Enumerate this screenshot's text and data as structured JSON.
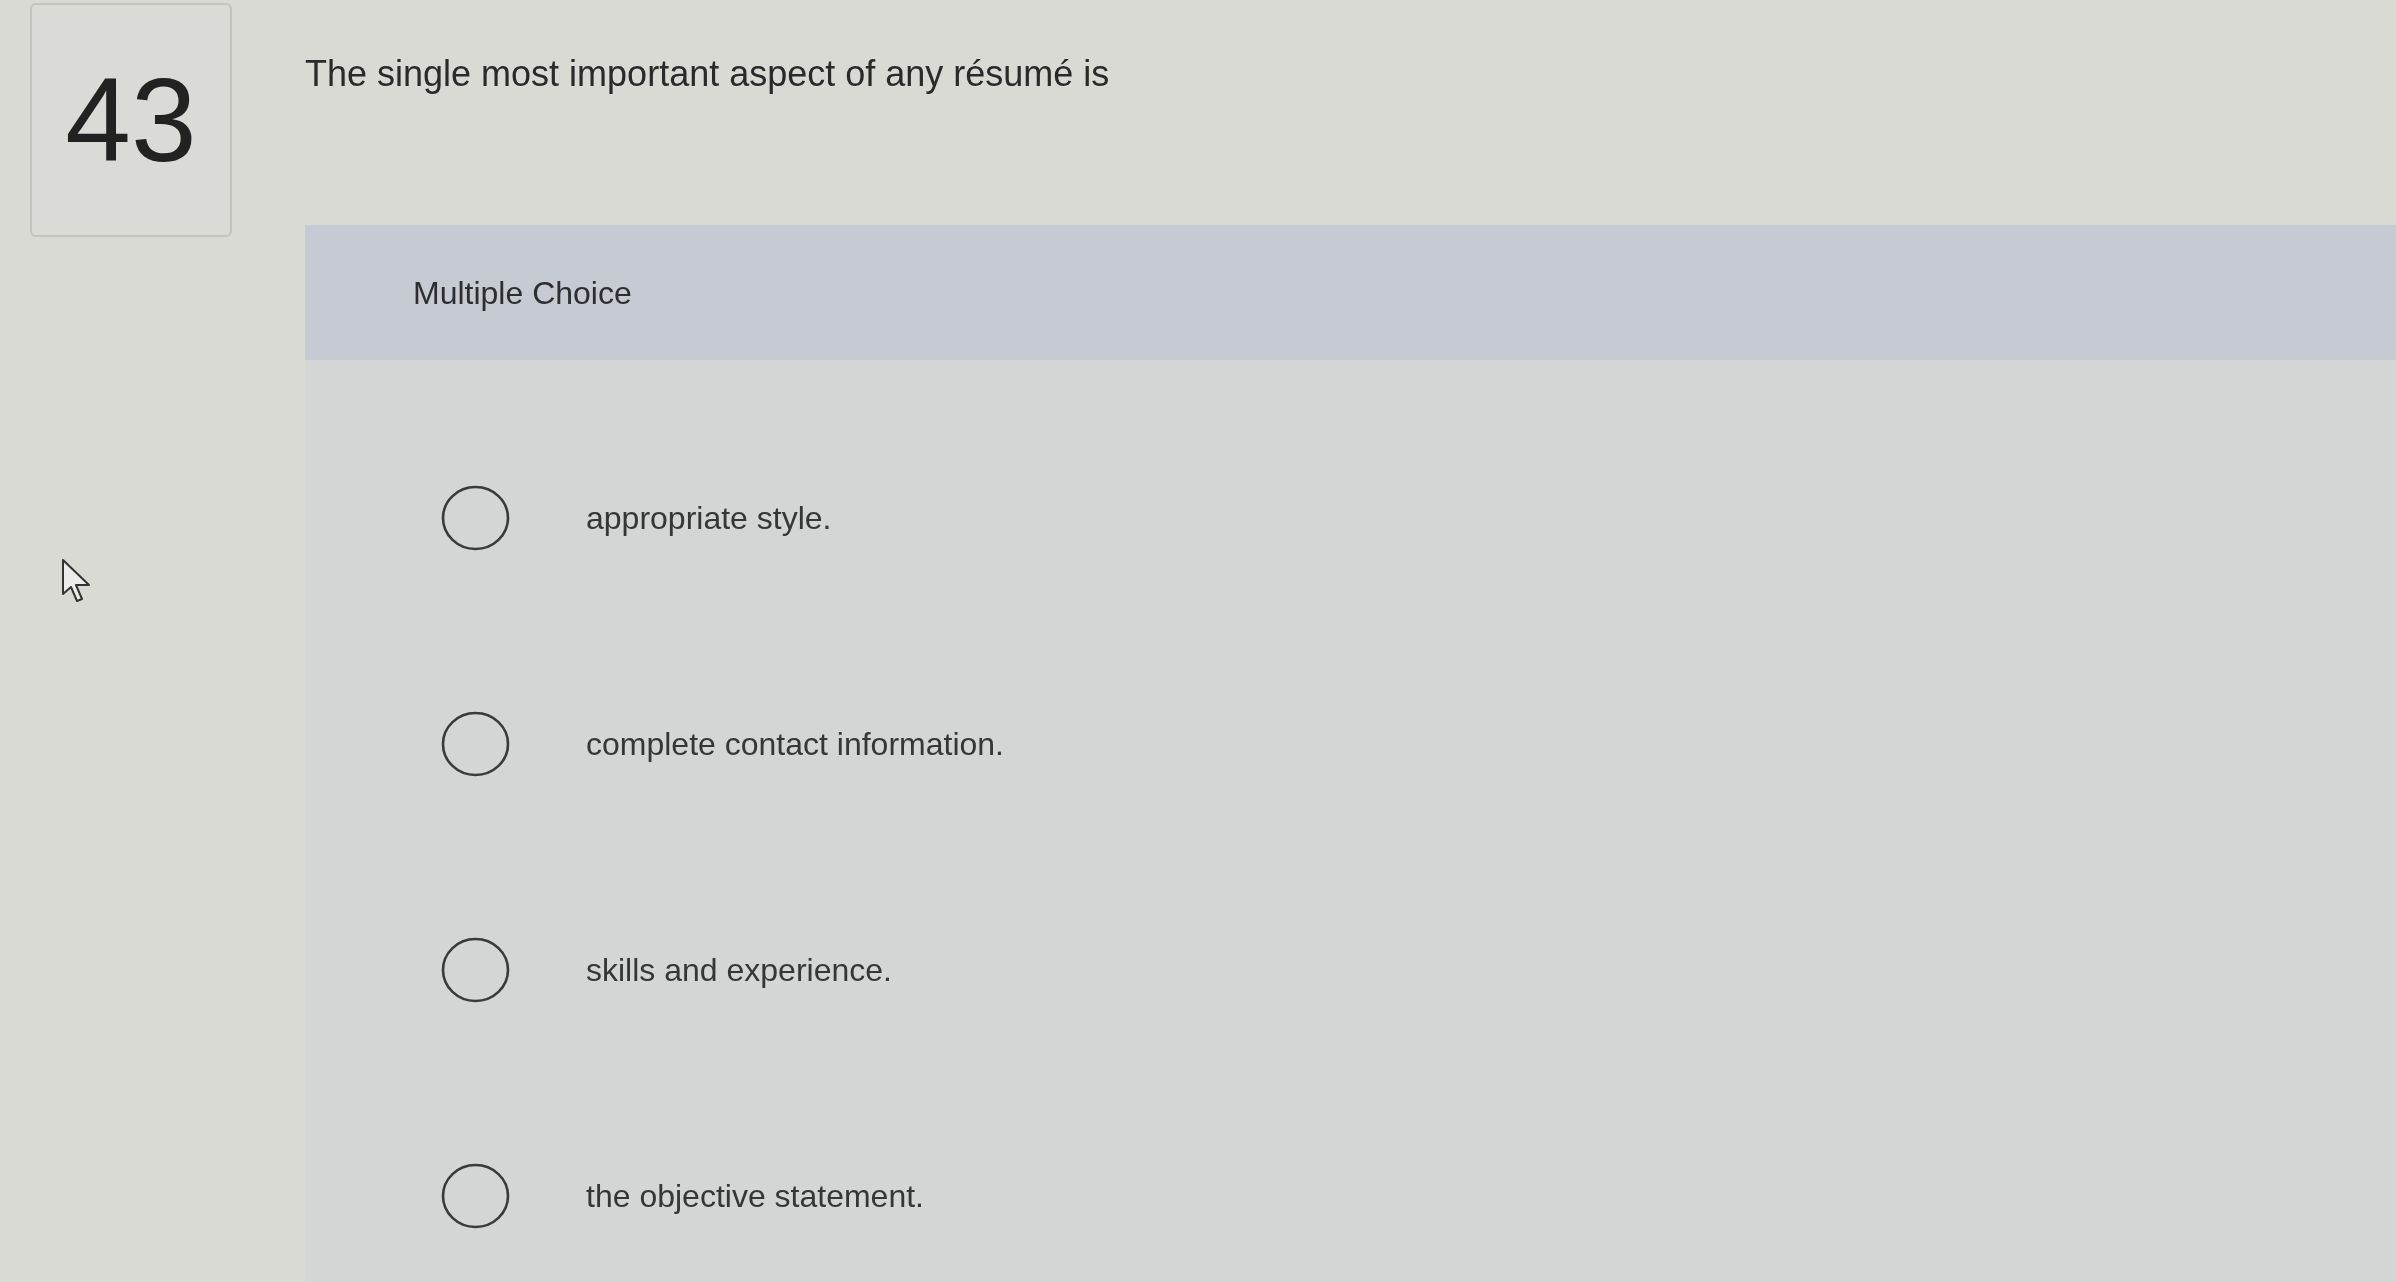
{
  "question": {
    "number": "43",
    "text": "The single most important aspect of any résumé is"
  },
  "answer_panel": {
    "type_label": "Multiple Choice",
    "options": [
      {
        "label": "appropriate style.",
        "selected": false
      },
      {
        "label": "complete contact information.",
        "selected": false
      },
      {
        "label": "skills and experience.",
        "selected": false
      },
      {
        "label": "the objective statement.",
        "selected": false
      }
    ]
  }
}
